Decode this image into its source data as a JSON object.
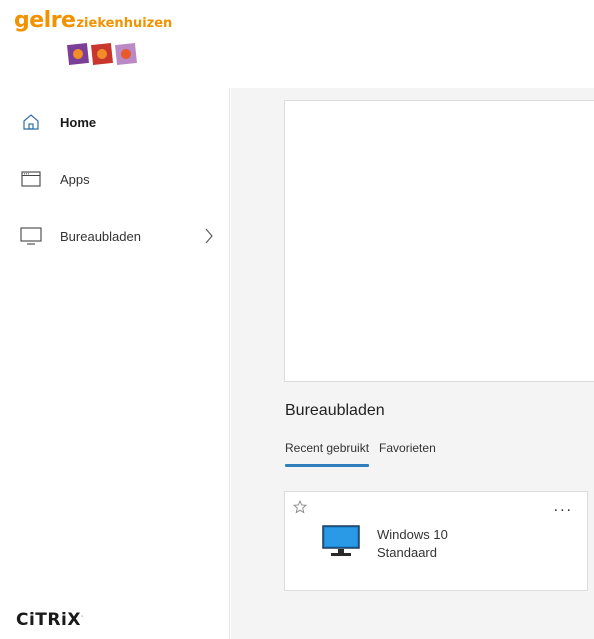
{
  "header": {
    "logo_main": "gelre",
    "logo_sub": "ziekenhuizen",
    "logo_squares": [
      {
        "bg": "#7b3f98",
        "dot": "#f28c28"
      },
      {
        "bg": "#c8362e",
        "dot": "#f28c28"
      },
      {
        "bg": "#b98ac6",
        "dot": "#e85a2a"
      }
    ]
  },
  "sidebar": {
    "items": [
      {
        "label": "Home",
        "icon": "home-icon",
        "active": true
      },
      {
        "label": "Apps",
        "icon": "apps-window-icon",
        "active": false
      },
      {
        "label": "Bureaubladen",
        "icon": "desktop-icon",
        "active": false,
        "has_chevron": true
      }
    ],
    "footer_brand": "CiTRiX"
  },
  "main": {
    "section_title": "Bureaubladen",
    "tabs": [
      {
        "label": "Recent gebruikt",
        "active": true
      },
      {
        "label": "Favorieten",
        "active": false
      }
    ],
    "card": {
      "title_line1": "Windows 10",
      "title_line2": "Standaard",
      "star_icon": "star-outline-icon",
      "more_label": "..."
    }
  },
  "colors": {
    "accent": "#2f7fbf",
    "logo_orange": "#f39200",
    "main_bg": "#f4f4f4",
    "monitor_blue": "#1e88d6"
  }
}
